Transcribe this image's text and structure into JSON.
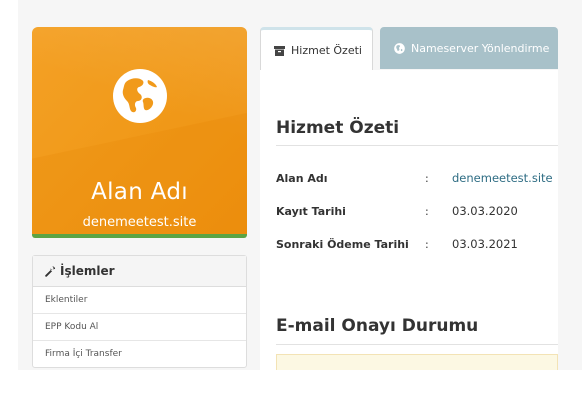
{
  "domain_card": {
    "title": "Alan Adı",
    "domain": "denemeetest.site",
    "icon": "globe-icon",
    "background_color": "#f19a1a",
    "accent_bar_color": "#5ca444"
  },
  "actions": {
    "title": "İşlemler",
    "icon": "wrench-icon",
    "items": [
      {
        "label": "Eklentiler"
      },
      {
        "label": "EPP Kodu Al"
      },
      {
        "label": "Firma İçi Transfer"
      }
    ]
  },
  "tabs": [
    {
      "label": "Hizmet Özeti",
      "icon": "archive-icon",
      "active": true
    },
    {
      "label": "Nameserver Yönlendirme",
      "icon": "globe-icon",
      "active": false,
      "color": "#a8c1c9"
    }
  ],
  "summary": {
    "title": "Hizmet Özeti",
    "rows": [
      {
        "label": "Alan Adı",
        "separator": ":",
        "value": "denemeetest.site"
      },
      {
        "label": "Kayıt Tarihi",
        "separator": ":",
        "value": "03.03.2020"
      },
      {
        "label": "Sonraki Ödeme Tarihi",
        "separator": ":",
        "value": "03.03.2021"
      }
    ],
    "link_color": "#2f6d84"
  },
  "email_verification": {
    "title": "E-mail Onayı Durumu"
  }
}
